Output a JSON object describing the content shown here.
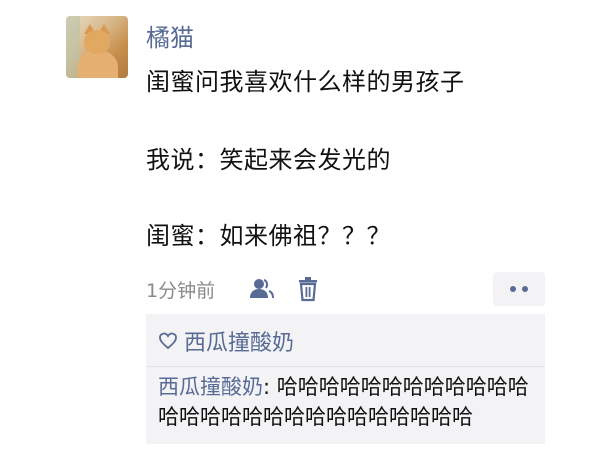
{
  "post": {
    "author": "橘猫",
    "lines": [
      "闺蜜问我喜欢什么样的男孩子",
      "我说：笑起来会发光的",
      "闺蜜：如来佛祖？？？"
    ],
    "time": "1分钟前"
  },
  "icons": {
    "friend": "friend-visibility-icon",
    "delete": "trash-icon",
    "more": "more-dots-icon",
    "like": "heart-outline-icon"
  },
  "interactions": {
    "likes": [
      "西瓜撞酸奶"
    ],
    "comment": {
      "author": "西瓜撞酸奶",
      "separator": ": ",
      "text": "哈哈哈哈哈哈哈哈哈哈哈哈哈哈哈哈哈哈哈哈哈哈哈哈哈哈哈"
    }
  },
  "colors": {
    "link": "#576b95",
    "meta": "#8a8a8a",
    "panel": "#f3f3f5"
  }
}
